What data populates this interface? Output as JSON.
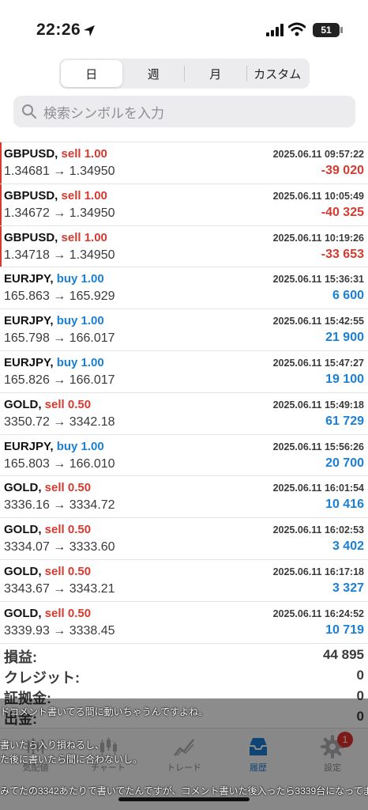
{
  "status_bar": {
    "time": "22:26",
    "battery": "51"
  },
  "segments": [
    {
      "label": "日",
      "active": true
    },
    {
      "label": "週",
      "active": false
    },
    {
      "label": "月",
      "active": false
    },
    {
      "label": "カスタム",
      "active": false
    }
  ],
  "search": {
    "placeholder": "検索シンボルを入力"
  },
  "trades": [
    {
      "symbol": "GBPUSD,",
      "side": "sell 1.00",
      "dir": "sell",
      "time": "2025.06.11 09:57:22",
      "prices": "1.34681 → 1.34950",
      "profit": "-39 020",
      "neg": true
    },
    {
      "symbol": "GBPUSD,",
      "side": "sell 1.00",
      "dir": "sell",
      "time": "2025.06.11 10:05:49",
      "prices": "1.34672 → 1.34950",
      "profit": "-40 325",
      "neg": true
    },
    {
      "symbol": "GBPUSD,",
      "side": "sell 1.00",
      "dir": "sell",
      "time": "2025.06.11 10:19:26",
      "prices": "1.34718 → 1.34950",
      "profit": "-33 653",
      "neg": true
    },
    {
      "symbol": "EURJPY,",
      "side": "buy 1.00",
      "dir": "buy",
      "time": "2025.06.11 15:36:31",
      "prices": "165.863 → 165.929",
      "profit": "6 600",
      "neg": false
    },
    {
      "symbol": "EURJPY,",
      "side": "buy 1.00",
      "dir": "buy",
      "time": "2025.06.11 15:42:55",
      "prices": "165.798 → 166.017",
      "profit": "21 900",
      "neg": false
    },
    {
      "symbol": "EURJPY,",
      "side": "buy 1.00",
      "dir": "buy",
      "time": "2025.06.11 15:47:27",
      "prices": "165.826 → 166.017",
      "profit": "19 100",
      "neg": false
    },
    {
      "symbol": "GOLD,",
      "side": "sell 0.50",
      "dir": "sell",
      "time": "2025.06.11 15:49:18",
      "prices": "3350.72 → 3342.18",
      "profit": "61 729",
      "neg": false
    },
    {
      "symbol": "EURJPY,",
      "side": "buy 1.00",
      "dir": "buy",
      "time": "2025.06.11 15:56:26",
      "prices": "165.803 → 166.010",
      "profit": "20 700",
      "neg": false
    },
    {
      "symbol": "GOLD,",
      "side": "sell 0.50",
      "dir": "sell",
      "time": "2025.06.11 16:01:54",
      "prices": "3336.16 → 3334.72",
      "profit": "10 416",
      "neg": false
    },
    {
      "symbol": "GOLD,",
      "side": "sell 0.50",
      "dir": "sell",
      "time": "2025.06.11 16:02:53",
      "prices": "3334.07 → 3333.60",
      "profit": "3 402",
      "neg": false
    },
    {
      "symbol": "GOLD,",
      "side": "sell 0.50",
      "dir": "sell",
      "time": "2025.06.11 16:17:18",
      "prices": "3343.67 → 3343.21",
      "profit": "3 327",
      "neg": false
    },
    {
      "symbol": "GOLD,",
      "side": "sell 0.50",
      "dir": "sell",
      "time": "2025.06.11 16:24:52",
      "prices": "3339.93 → 3338.45",
      "profit": "10 719",
      "neg": false
    }
  ],
  "summary": [
    {
      "label": "損益:",
      "value": "44 895"
    },
    {
      "label": "クレジット:",
      "value": "0"
    },
    {
      "label": "証拠金:",
      "value": "0"
    },
    {
      "label": "出金:",
      "value": "0"
    }
  ],
  "tabs": [
    {
      "label": "気配値",
      "icon": "quotes-icon"
    },
    {
      "label": "チャート",
      "icon": "chart-icon"
    },
    {
      "label": "トレード",
      "icon": "trade-icon"
    },
    {
      "label": "履歴",
      "icon": "history-icon",
      "active": true
    },
    {
      "label": "設定",
      "icon": "settings-icon",
      "badge": "1"
    }
  ],
  "comments": [
    "ドコメント書いてる間に動いちゃうんですよね。",
    "書いたら入り損ねるし、",
    "た後に書いたら間に合わないし。",
    "みてたの3342あたりで書いてたんですが、コメント書いた後入ったら3339台になってまし"
  ],
  "colors": {
    "loss": "#d63a2f",
    "gain": "#1a7fd6",
    "active_tab": "#1a7fd6"
  }
}
